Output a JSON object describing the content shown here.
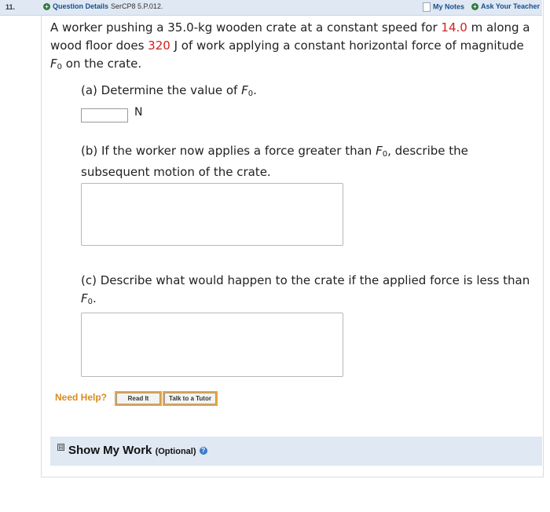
{
  "header": {
    "question_number": "11.",
    "question_details_label": "Question Details",
    "question_code": "SerCP8 5.P.012.",
    "my_notes_label": "My Notes",
    "ask_teacher_label": "Ask Your Teacher"
  },
  "question": {
    "text_1": "A worker pushing a 35.0-kg wooden crate at a constant speed for ",
    "distance": "14.0",
    "text_2": " m along a wood floor does ",
    "work": "320",
    "text_3": " J of work applying a constant horizontal force of magnitude ",
    "var_F": "F",
    "var_sub": "0",
    "text_4": " on the crate."
  },
  "part_a": {
    "text": "(a) Determine the value of ",
    "var_F": "F",
    "var_sub": "0",
    "end": ".",
    "answer_value": "",
    "unit": "N"
  },
  "part_b": {
    "text": "(b) If the worker now applies a force greater than ",
    "var_F": "F",
    "var_sub": "0",
    "text_2": ", describe the subsequent motion of the crate.",
    "answer_value": ""
  },
  "part_c": {
    "text": "(c) Describe what would happen to the crate if the applied force is less than ",
    "var_F": "F",
    "var_sub": "0",
    "end": ".",
    "answer_value": ""
  },
  "help": {
    "need_help_label": "Need Help?",
    "read_it_label": "Read It",
    "talk_tutor_label": "Talk to a Tutor"
  },
  "show_work": {
    "toggle_symbol": "⊟",
    "title": "Show My Work",
    "optional": "(Optional)",
    "help_symbol": "?"
  },
  "colors": {
    "header_bg": "#dfe8f3",
    "highlight_red": "#d21e1e",
    "need_help_orange": "#d98c1f",
    "link_blue": "#1a4e8a"
  }
}
